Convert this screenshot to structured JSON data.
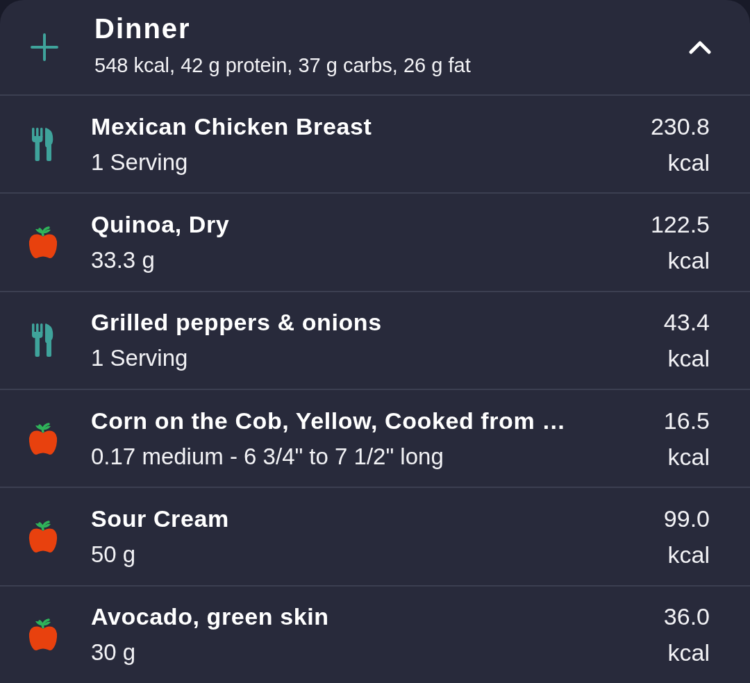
{
  "meal": {
    "title": "Dinner",
    "summary": "548 kcal, 42 g protein, 37 g carbs, 26 g fat",
    "expanded": true
  },
  "entries": [
    {
      "kind": "recipe",
      "name": "Mexican Chicken Breast",
      "amount": "1 Serving",
      "calories": "230.8",
      "unit": "kcal"
    },
    {
      "kind": "food",
      "name": "Quinoa, Dry",
      "amount": "33.3 g",
      "calories": "122.5",
      "unit": "kcal"
    },
    {
      "kind": "recipe",
      "name": "Grilled peppers & onions",
      "amount": "1 Serving",
      "calories": "43.4",
      "unit": "kcal"
    },
    {
      "kind": "food",
      "name": "Corn on the Cob, Yellow, Cooked from …",
      "amount": "0.17 medium - 6 3/4\" to 7 1/2\" long",
      "calories": "16.5",
      "unit": "kcal"
    },
    {
      "kind": "food",
      "name": "Sour Cream",
      "amount": "50 g",
      "calories": "99.0",
      "unit": "kcal"
    },
    {
      "kind": "food",
      "name": "Avocado, green skin",
      "amount": "30 g",
      "calories": "36.0",
      "unit": "kcal"
    }
  ]
}
